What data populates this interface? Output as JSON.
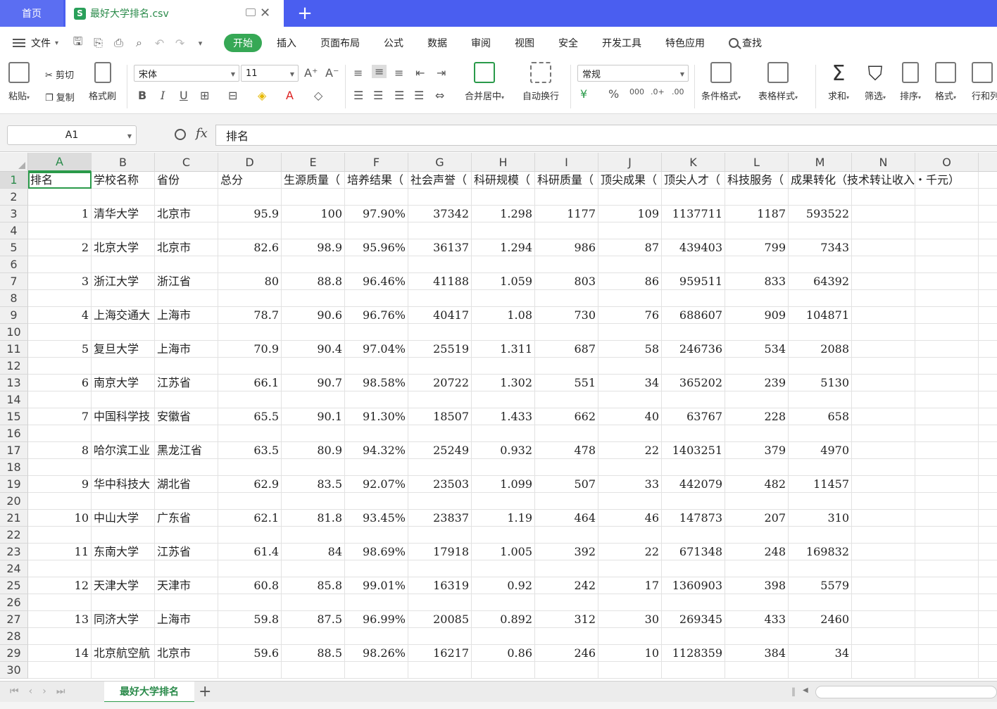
{
  "tabs": {
    "home": "首页",
    "file_name": "最好大学排名.csv",
    "file_icon_letter": "S"
  },
  "menu": {
    "file": "文件",
    "items": [
      "开始",
      "插入",
      "页面布局",
      "公式",
      "数据",
      "审阅",
      "视图",
      "安全",
      "开发工具",
      "特色应用"
    ],
    "search": "查找"
  },
  "ribbon": {
    "paste": "粘贴",
    "cut": "剪切",
    "copy": "复制",
    "format_painter": "格式刷",
    "font_name": "宋体",
    "font_size": "11",
    "merge_center": "合并居中",
    "wrap_text": "自动换行",
    "number_format": "常规",
    "cond_format": "条件格式",
    "table_style": "表格样式",
    "sum": "求和",
    "filter": "筛选",
    "sort": "排序",
    "format": "格式",
    "row_col": "行和列"
  },
  "formula_bar": {
    "name_box": "A1",
    "fx": "fx",
    "content": "排名"
  },
  "columns": [
    "A",
    "B",
    "C",
    "D",
    "E",
    "F",
    "G",
    "H",
    "I",
    "J",
    "K",
    "L",
    "M",
    "N",
    "O"
  ],
  "rows": [
    "1",
    "2",
    "3",
    "4",
    "5",
    "6",
    "7",
    "8",
    "9",
    "10",
    "11",
    "12",
    "13",
    "14",
    "15",
    "16",
    "17",
    "18",
    "19",
    "20",
    "21",
    "22",
    "23",
    "24",
    "25",
    "26",
    "27",
    "28",
    "29",
    "30"
  ],
  "header_row": [
    "排名",
    "学校名称",
    "省份",
    "总分",
    "生源质量（",
    "培养结果（",
    "社会声誉（",
    "科研规模（",
    "科研质量（",
    "顶尖成果（",
    "顶尖人才（",
    "科技服务（",
    "成果转化（技术转让收入・千元）"
  ],
  "data_rows": [
    [
      "1",
      "清华大学",
      "北京市",
      "95.9",
      "100",
      "97.90%",
      "37342",
      "1.298",
      "1177",
      "109",
      "1137711",
      "1187",
      "593522"
    ],
    [
      "2",
      "北京大学",
      "北京市",
      "82.6",
      "98.9",
      "95.96%",
      "36137",
      "1.294",
      "986",
      "87",
      "439403",
      "799",
      "7343"
    ],
    [
      "3",
      "浙江大学",
      "浙江省",
      "80",
      "88.8",
      "96.46%",
      "41188",
      "1.059",
      "803",
      "86",
      "959511",
      "833",
      "64392"
    ],
    [
      "4",
      "上海交通大",
      "上海市",
      "78.7",
      "90.6",
      "96.76%",
      "40417",
      "1.08",
      "730",
      "76",
      "688607",
      "909",
      "104871"
    ],
    [
      "5",
      "复旦大学",
      "上海市",
      "70.9",
      "90.4",
      "97.04%",
      "25519",
      "1.311",
      "687",
      "58",
      "246736",
      "534",
      "2088"
    ],
    [
      "6",
      "南京大学",
      "江苏省",
      "66.1",
      "90.7",
      "98.58%",
      "20722",
      "1.302",
      "551",
      "34",
      "365202",
      "239",
      "5130"
    ],
    [
      "7",
      "中国科学技",
      "安徽省",
      "65.5",
      "90.1",
      "91.30%",
      "18507",
      "1.433",
      "662",
      "40",
      "63767",
      "228",
      "658"
    ],
    [
      "8",
      "哈尔滨工业",
      "黑龙江省",
      "63.5",
      "80.9",
      "94.32%",
      "25249",
      "0.932",
      "478",
      "22",
      "1403251",
      "379",
      "4970"
    ],
    [
      "9",
      "华中科技大",
      "湖北省",
      "62.9",
      "83.5",
      "92.07%",
      "23503",
      "1.099",
      "507",
      "33",
      "442079",
      "482",
      "11457"
    ],
    [
      "10",
      "中山大学",
      "广东省",
      "62.1",
      "81.8",
      "93.45%",
      "23837",
      "1.19",
      "464",
      "46",
      "147873",
      "207",
      "310"
    ],
    [
      "11",
      "东南大学",
      "江苏省",
      "61.4",
      "84",
      "98.69%",
      "17918",
      "1.005",
      "392",
      "22",
      "671348",
      "248",
      "169832"
    ],
    [
      "12",
      "天津大学",
      "天津市",
      "60.8",
      "85.8",
      "99.01%",
      "16319",
      "0.92",
      "242",
      "17",
      "1360903",
      "398",
      "5579"
    ],
    [
      "13",
      "同济大学",
      "上海市",
      "59.8",
      "87.5",
      "96.99%",
      "20085",
      "0.892",
      "312",
      "30",
      "269345",
      "433",
      "2460"
    ],
    [
      "14",
      "北京航空航",
      "北京市",
      "59.6",
      "88.5",
      "98.26%",
      "16217",
      "0.86",
      "246",
      "10",
      "1128359",
      "384",
      "34"
    ]
  ],
  "sheet": {
    "name": "最好大学排名",
    "add": "+"
  }
}
